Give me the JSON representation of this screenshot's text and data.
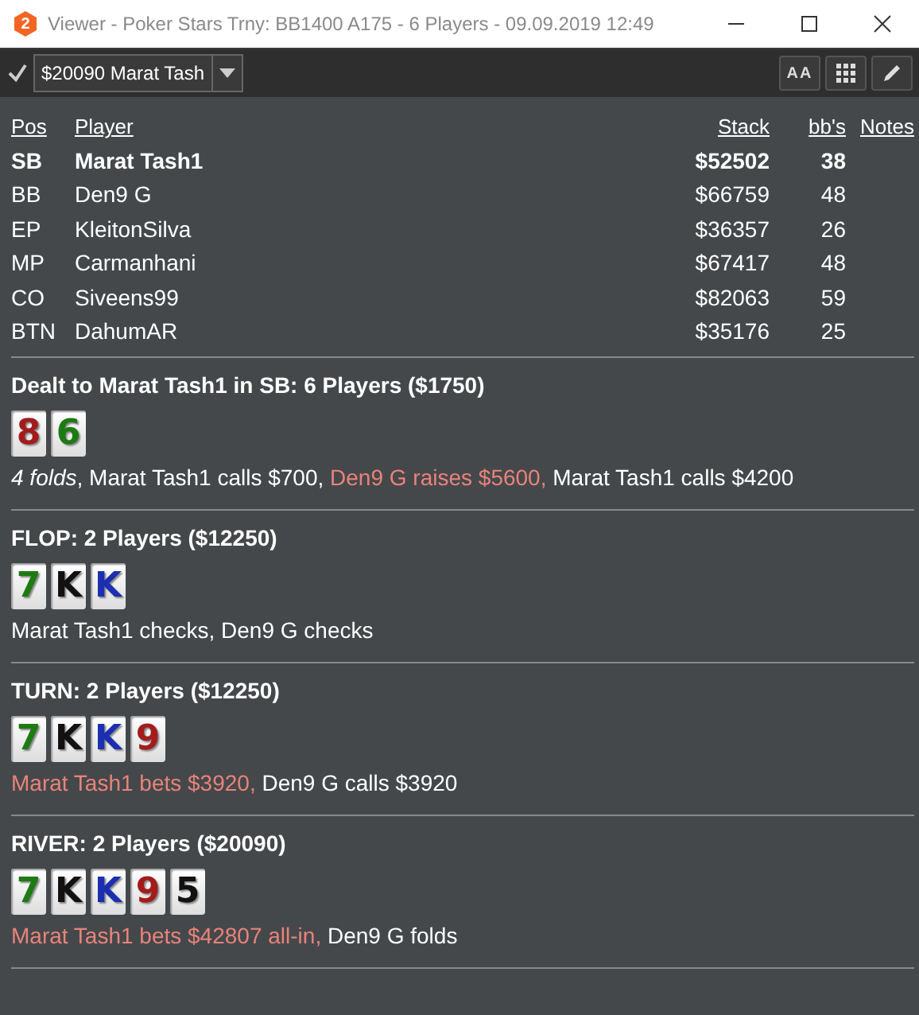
{
  "window": {
    "app_icon": "2",
    "title": "Viewer - Poker Stars Trny: BB1400 A175 - 6 Players - 09.09.2019 12:49"
  },
  "toolbar": {
    "checked": true,
    "hand_select": {
      "value": "$20090 Marat Tash"
    },
    "font_button": "AA"
  },
  "table": {
    "columns": [
      "Pos",
      "Player",
      "Stack",
      "bb's",
      "Notes"
    ],
    "rows": [
      {
        "pos": "SB",
        "player": "Marat Tash1",
        "stack": "$52502",
        "bbs": "38",
        "hero": true
      },
      {
        "pos": "BB",
        "player": "Den9 G",
        "stack": "$66759",
        "bbs": "48",
        "hero": false
      },
      {
        "pos": "EP",
        "player": "KleitonSilva",
        "stack": "$36357",
        "bbs": "26",
        "hero": false
      },
      {
        "pos": "MP",
        "player": "Carmanhani",
        "stack": "$67417",
        "bbs": "48",
        "hero": false
      },
      {
        "pos": "CO",
        "player": "Siveens99",
        "stack": "$82063",
        "bbs": "59",
        "hero": false
      },
      {
        "pos": "BTN",
        "player": "DahumAR",
        "stack": "$35176",
        "bbs": "25",
        "hero": false
      }
    ]
  },
  "streets": [
    {
      "heading": "Dealt to Marat Tash1 in SB: 6 Players ($1750)",
      "cards": [
        {
          "rank": "8",
          "color": "#a31c1c"
        },
        {
          "rank": "6",
          "color": "#1e7a12"
        }
      ],
      "actions": [
        {
          "text": "4 folds",
          "kind": "summary"
        },
        {
          "text": ", Marat Tash1 calls $700, ",
          "kind": "passive"
        },
        {
          "text": "Den9 G raises $5600, ",
          "kind": "aggressive"
        },
        {
          "text": "Marat Tash1 calls $4200",
          "kind": "passive"
        }
      ]
    },
    {
      "heading": "FLOP: 2 Players ($12250)",
      "cards": [
        {
          "rank": "7",
          "color": "#1e7a12"
        },
        {
          "rank": "K",
          "color": "#111111"
        },
        {
          "rank": "K",
          "color": "#1c2fb0"
        }
      ],
      "actions": [
        {
          "text": "Marat Tash1 checks, Den9 G checks",
          "kind": "passive"
        }
      ]
    },
    {
      "heading": "TURN: 2 Players ($12250)",
      "cards": [
        {
          "rank": "7",
          "color": "#1e7a12"
        },
        {
          "rank": "K",
          "color": "#111111"
        },
        {
          "rank": "K",
          "color": "#1c2fb0"
        },
        {
          "rank": "9",
          "color": "#a31c1c"
        }
      ],
      "actions": [
        {
          "text": "Marat Tash1 bets $3920, ",
          "kind": "aggressive"
        },
        {
          "text": "Den9 G calls $3920",
          "kind": "passive"
        }
      ]
    },
    {
      "heading": "RIVER: 2 Players ($20090)",
      "cards": [
        {
          "rank": "7",
          "color": "#1e7a12"
        },
        {
          "rank": "K",
          "color": "#111111"
        },
        {
          "rank": "K",
          "color": "#1c2fb0"
        },
        {
          "rank": "9",
          "color": "#a31c1c"
        },
        {
          "rank": "5",
          "color": "#111111"
        }
      ],
      "actions": [
        {
          "text": "Marat Tash1 bets $42807 all-in, ",
          "kind": "aggressive"
        },
        {
          "text": "Den9 G folds",
          "kind": "passive"
        }
      ]
    }
  ]
}
